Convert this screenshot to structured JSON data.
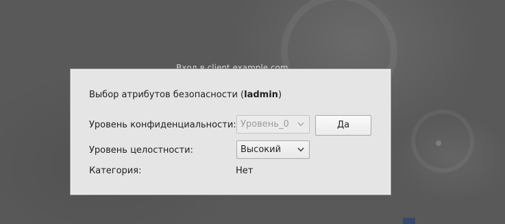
{
  "window": {
    "title": "Вход в client.example.com"
  },
  "dialog": {
    "title_prefix": "Выбор атрибутов безопасности (",
    "title_user": "ladmin",
    "title_suffix": ")",
    "confidentiality_label": "Уровень конфиденциальности:",
    "confidentiality_value": "Уровень_0",
    "confidentiality_enabled": false,
    "integrity_label": "Уровень целостности:",
    "integrity_value": "Высокий",
    "category_label": "Категория:",
    "category_value": "Нет",
    "ok_button": "Да"
  },
  "icons": {
    "combo_arrow": "chevron-down-icon"
  },
  "colors": {
    "dialog_bg": "#e5e5e5",
    "desktop_bg": "#595959",
    "disabled_text": "#9a9a9a"
  }
}
